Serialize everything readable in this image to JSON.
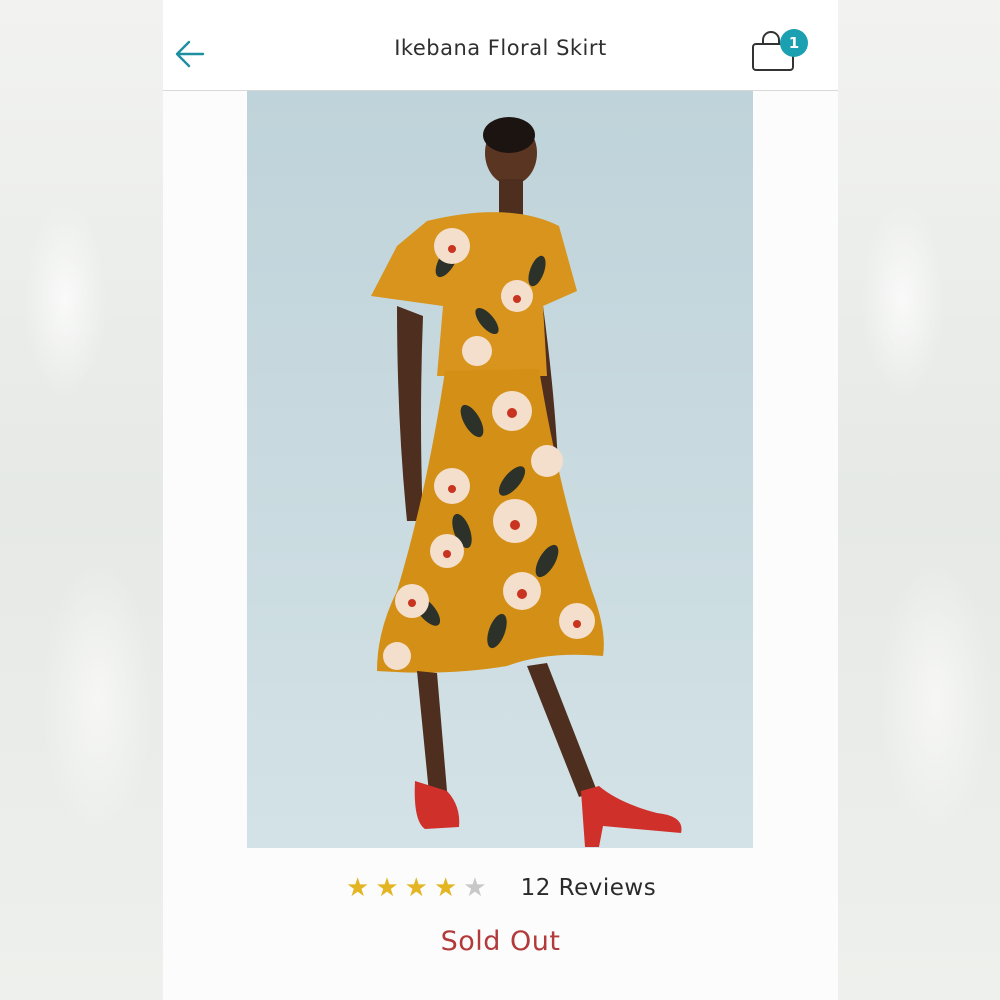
{
  "header": {
    "title": "Ikebana Floral Skirt",
    "back_icon": "arrow-left-icon",
    "bag_icon": "shopping-bag-icon",
    "bag_count": "1"
  },
  "product": {
    "image_description_icon": "product-photo"
  },
  "rating": {
    "stars": 4,
    "max_stars": 5,
    "reviews_label": "12 Reviews"
  },
  "status": {
    "label": "Sold Out"
  },
  "colors": {
    "accent": "#1aa0b0",
    "star": "#e4b523",
    "sold_out": "#b33a3a"
  }
}
